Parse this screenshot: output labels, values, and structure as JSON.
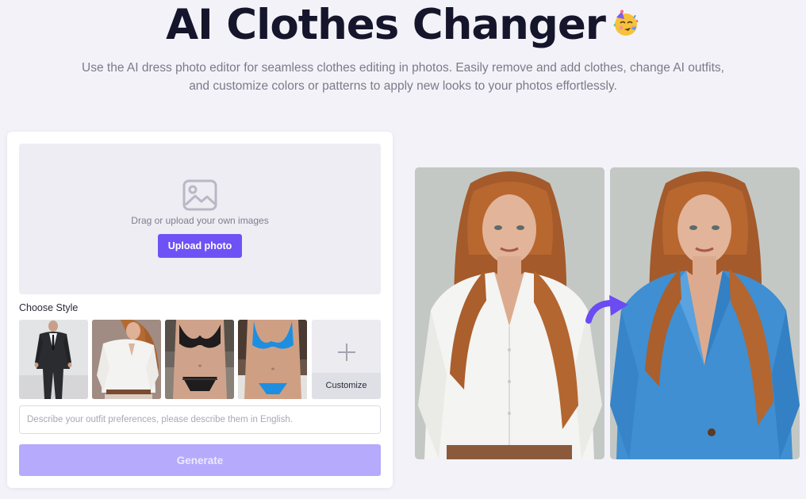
{
  "hero": {
    "title": "AI Clothes Changer",
    "title_emoji_icon": "party-face-icon",
    "subtitle": "Use the AI dress photo editor for seamless clothes editing in photos. Easily remove and add clothes, change AI outfits, and customize colors or patterns to apply new looks to your photos effortlessly."
  },
  "upload": {
    "icon": "image-icon",
    "hint": "Drag or upload your own images",
    "button_label": "Upload photo"
  },
  "styles": {
    "label": "Choose Style",
    "items": [
      {
        "name": "black suit",
        "icon": "style-suit-thumbnail"
      },
      {
        "name": "white shirt",
        "icon": "style-shirt-thumbnail"
      },
      {
        "name": "black lingerie",
        "icon": "style-lingerie-thumbnail"
      },
      {
        "name": "blue bikini",
        "icon": "style-bikini-thumbnail"
      }
    ],
    "customize_label": "Customize",
    "customize_icon": "plus-icon"
  },
  "prompt": {
    "placeholder": "Describe your outfit preferences, please describe them in English.",
    "value": ""
  },
  "generate": {
    "label": "Generate"
  },
  "preview": {
    "before_image": "woman in white shirt",
    "after_image": "woman in blue blazer",
    "arrow_icon": "curved-arrow-icon"
  },
  "colors": {
    "accent": "#6f52f5",
    "accent_disabled": "#b5aafb",
    "page_bg": "#f3f2f8",
    "title": "#15152b",
    "blazer_blue": "#3f8fd2"
  }
}
